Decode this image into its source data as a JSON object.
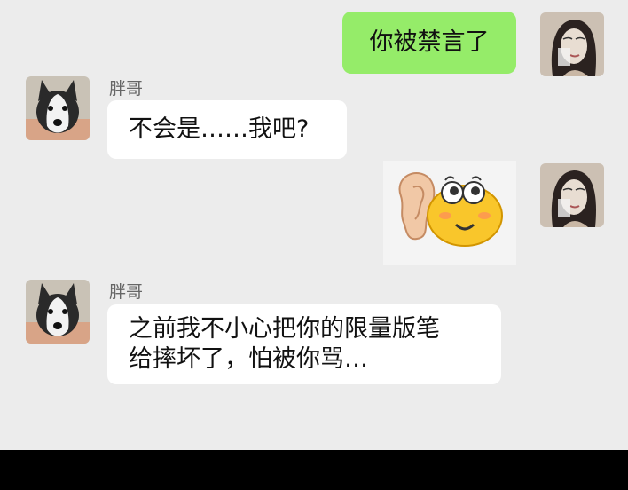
{
  "messages": [
    {
      "sender": "me",
      "text": "你被禁言了"
    },
    {
      "sender": "other",
      "name": "胖哥",
      "text": "不会是……我吧?"
    },
    {
      "sender": "me",
      "type": "sticker",
      "sticker": "ear-and-smiley-emoji"
    },
    {
      "sender": "other",
      "name": "胖哥",
      "text_line1": "之前我不小心把你的限量版笔",
      "text_line2": "给摔坏了，怕被你骂…"
    }
  ],
  "colors": {
    "background": "#ececec",
    "my_bubble": "#95ec69",
    "other_bubble": "#ffffff",
    "bottom_bar": "#000000"
  }
}
